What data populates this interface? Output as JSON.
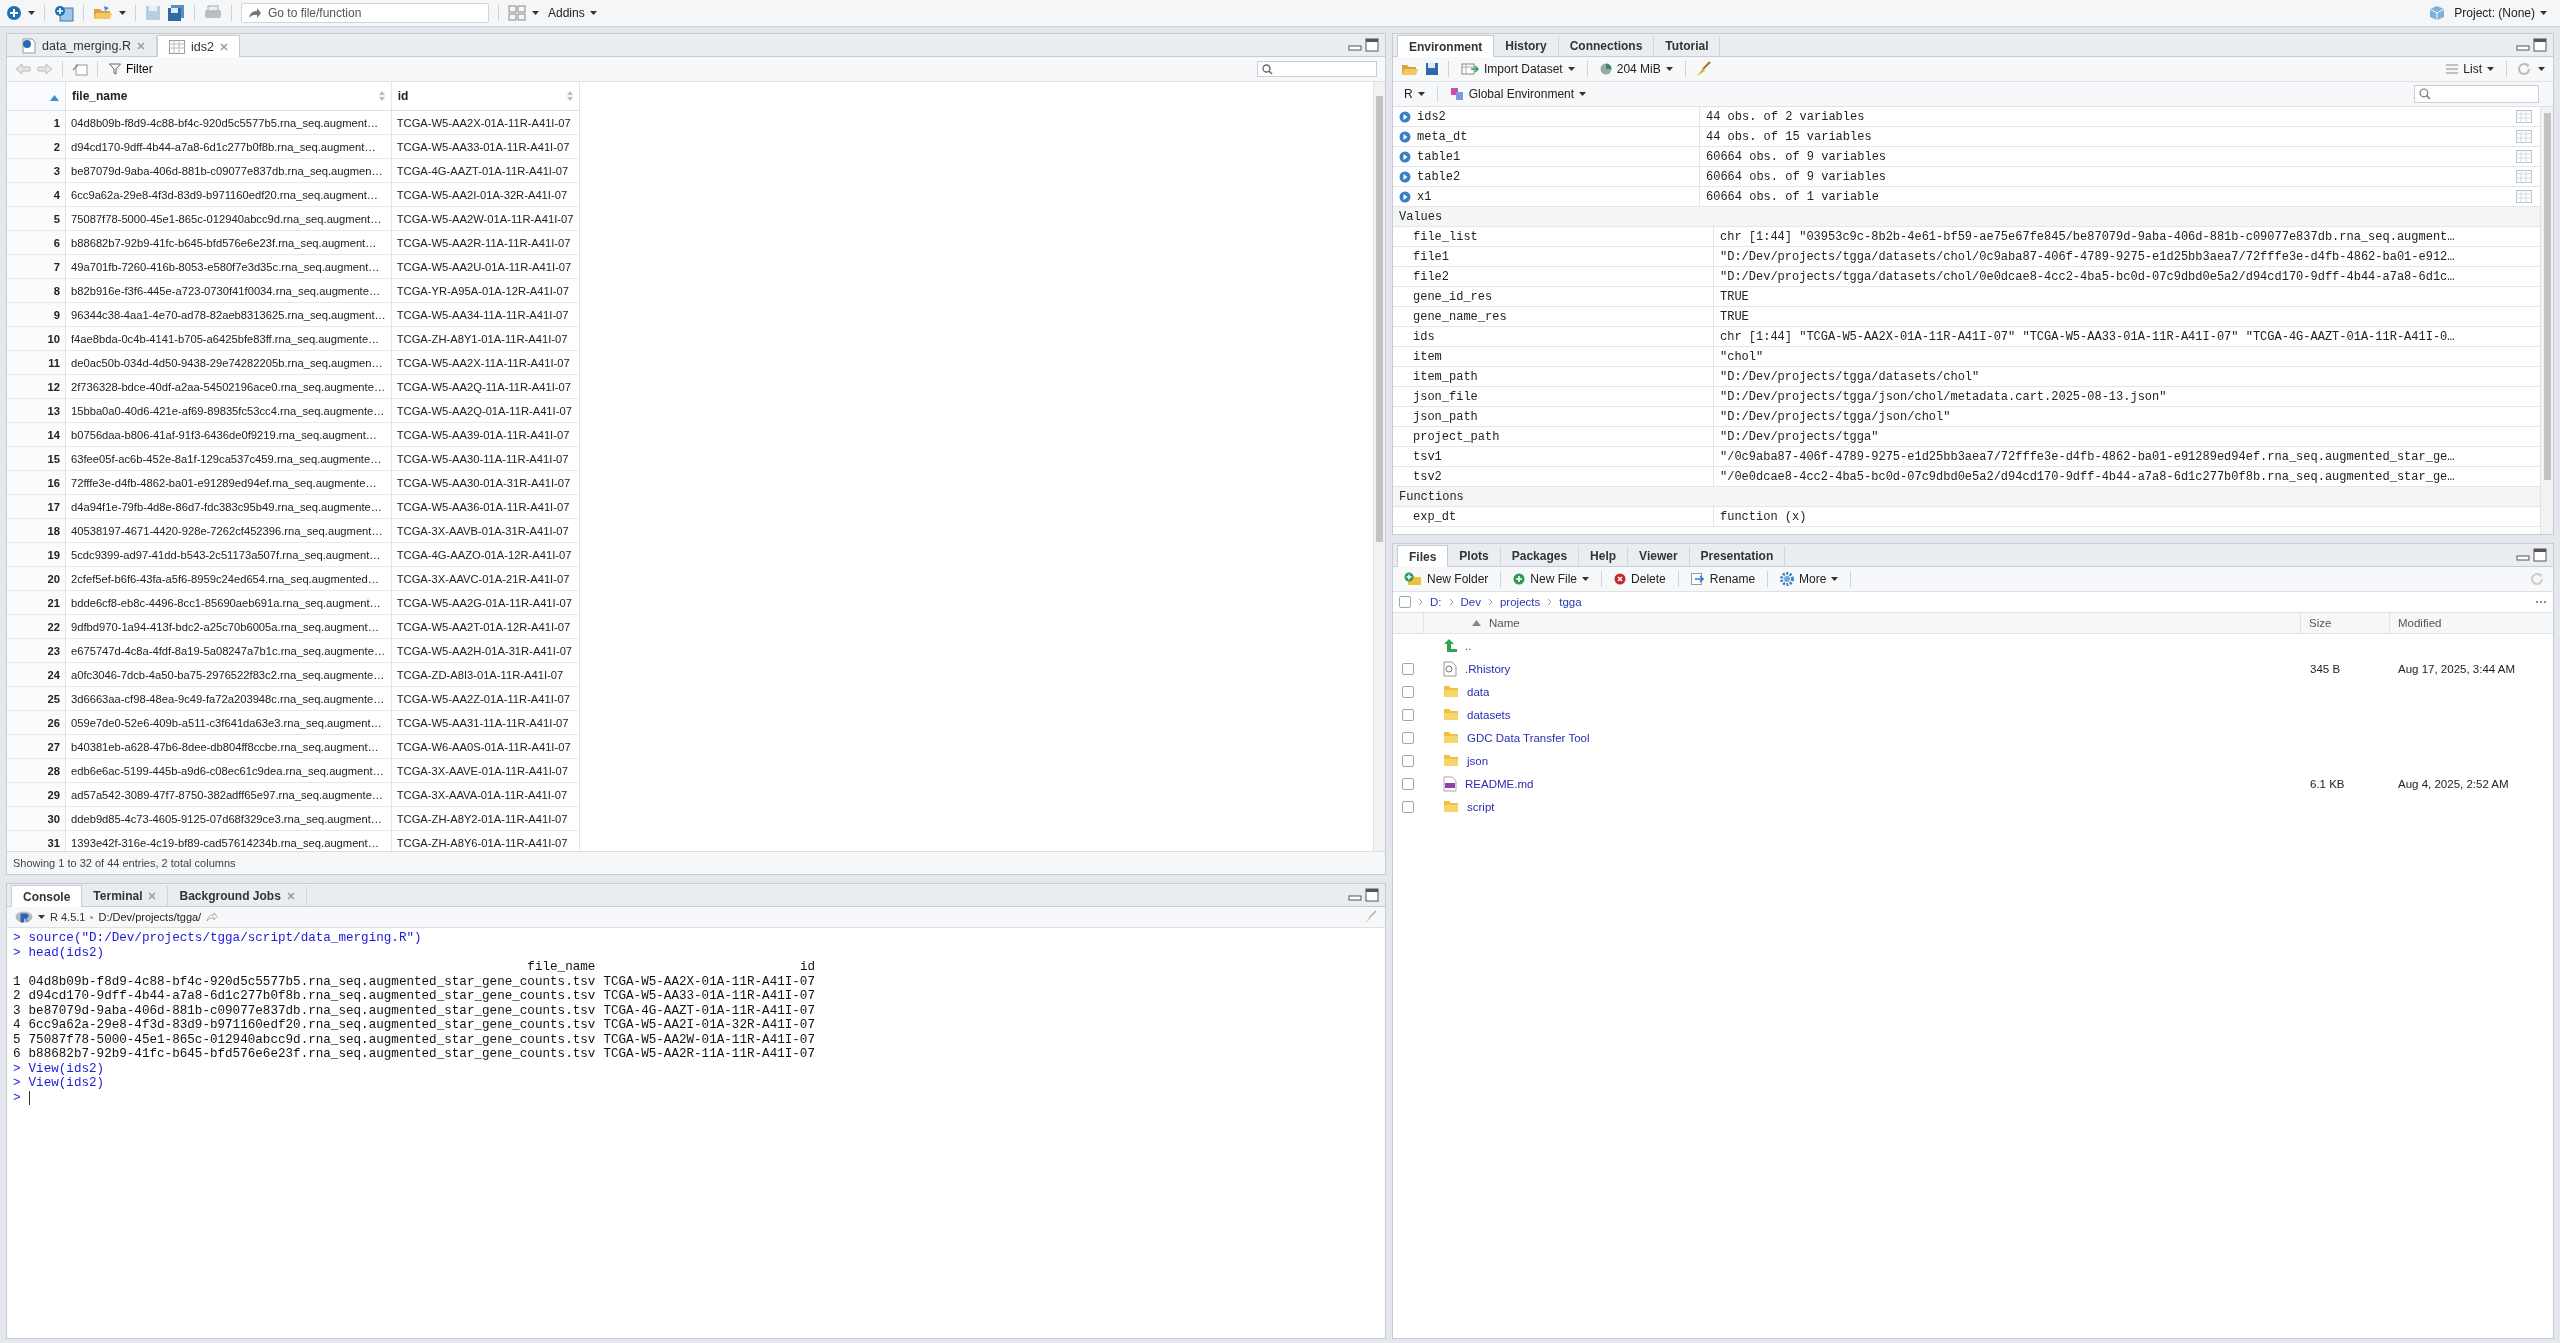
{
  "toolbar": {
    "goto": {
      "placeholder": "Go to file/function"
    },
    "addins": "Addins",
    "project": "Project: (None)"
  },
  "source_pane": {
    "tabs": [
      {
        "label": "data_merging.R",
        "kind": "script",
        "selected": false
      },
      {
        "label": "ids2",
        "kind": "table",
        "selected": true
      }
    ],
    "filter": "Filter",
    "table": {
      "columns": [
        "file_name",
        "id"
      ],
      "rows": [
        {
          "n": "1",
          "file_name": "04d8b09b-f8d9-4c88-bf4c-920d5c5577b5.rna_seq.augment…",
          "id": "TCGA-W5-AA2X-01A-11R-A41I-07"
        },
        {
          "n": "2",
          "file_name": "d94cd170-9dff-4b44-a7a8-6d1c277b0f8b.rna_seq.augment…",
          "id": "TCGA-W5-AA33-01A-11R-A41I-07"
        },
        {
          "n": "3",
          "file_name": "be87079d-9aba-406d-881b-c09077e837db.rna_seq.augmen…",
          "id": "TCGA-4G-AAZT-01A-11R-A41I-07"
        },
        {
          "n": "4",
          "file_name": "6cc9a62a-29e8-4f3d-83d9-b971160edf20.rna_seq.augment…",
          "id": "TCGA-W5-AA2I-01A-32R-A41I-07"
        },
        {
          "n": "5",
          "file_name": "75087f78-5000-45e1-865c-012940abcc9d.rna_seq.augment…",
          "id": "TCGA-W5-AA2W-01A-11R-A41I-07"
        },
        {
          "n": "6",
          "file_name": "b88682b7-92b9-41fc-b645-bfd576e6e23f.rna_seq.augment…",
          "id": "TCGA-W5-AA2R-11A-11R-A41I-07"
        },
        {
          "n": "7",
          "file_name": "49a701fb-7260-416b-8053-e580f7e3d35c.rna_seq.augment…",
          "id": "TCGA-W5-AA2U-01A-11R-A41I-07"
        },
        {
          "n": "8",
          "file_name": "b82b916e-f3f6-445e-a723-0730f41f0034.rna_seq.augmente…",
          "id": "TCGA-YR-A95A-01A-12R-A41I-07"
        },
        {
          "n": "9",
          "file_name": "96344c38-4aa1-4e70-ad78-82aeb8313625.rna_seq.augment…",
          "id": "TCGA-W5-AA34-11A-11R-A41I-07"
        },
        {
          "n": "10",
          "file_name": "f4ae8bda-0c4b-4141-b705-a6425bfe83ff.rna_seq.augmente…",
          "id": "TCGA-ZH-A8Y1-01A-11R-A41I-07"
        },
        {
          "n": "11",
          "file_name": "de0ac50b-034d-4d50-9438-29e74282205b.rna_seq.augmen…",
          "id": "TCGA-W5-AA2X-11A-11R-A41I-07"
        },
        {
          "n": "12",
          "file_name": "2f736328-bdce-40df-a2aa-54502196ace0.rna_seq.augmente…",
          "id": "TCGA-W5-AA2Q-11A-11R-A41I-07"
        },
        {
          "n": "13",
          "file_name": "15bba0a0-40d6-421e-af69-89835fc53cc4.rna_seq.augmente…",
          "id": "TCGA-W5-AA2Q-01A-11R-A41I-07"
        },
        {
          "n": "14",
          "file_name": "b0756daa-b806-41af-91f3-6436de0f9219.rna_seq.augment…",
          "id": "TCGA-W5-AA39-01A-11R-A41I-07"
        },
        {
          "n": "15",
          "file_name": "63fee05f-ac6b-452e-8a1f-129ca537c459.rna_seq.augmente…",
          "id": "TCGA-W5-AA30-11A-11R-A41I-07"
        },
        {
          "n": "16",
          "file_name": "72fffe3e-d4fb-4862-ba01-e91289ed94ef.rna_seq.augmente…",
          "id": "TCGA-W5-AA30-01A-31R-A41I-07"
        },
        {
          "n": "17",
          "file_name": "d4a94f1e-79fb-4d8e-86d7-fdc383c95b49.rna_seq.augmente…",
          "id": "TCGA-W5-AA36-01A-11R-A41I-07"
        },
        {
          "n": "18",
          "file_name": "40538197-4671-4420-928e-7262cf452396.rna_seq.augment…",
          "id": "TCGA-3X-AAVB-01A-31R-A41I-07"
        },
        {
          "n": "19",
          "file_name": "5cdc9399-ad97-41dd-b543-2c51173a507f.rna_seq.augment…",
          "id": "TCGA-4G-AAZO-01A-12R-A41I-07"
        },
        {
          "n": "20",
          "file_name": "2cfef5ef-b6f6-43fa-a5f6-8959c24ed654.rna_seq.augmented…",
          "id": "TCGA-3X-AAVC-01A-21R-A41I-07"
        },
        {
          "n": "21",
          "file_name": "bdde6cf8-eb8c-4496-8cc1-85690aeb691a.rna_seq.augment…",
          "id": "TCGA-W5-AA2G-01A-11R-A41I-07"
        },
        {
          "n": "22",
          "file_name": "9dfbd970-1a94-413f-bdc2-a25c70b6005a.rna_seq.augment…",
          "id": "TCGA-W5-AA2T-01A-12R-A41I-07"
        },
        {
          "n": "23",
          "file_name": "e675747d-4c8a-4fdf-8a19-5a08247a7b1c.rna_seq.augmente…",
          "id": "TCGA-W5-AA2H-01A-31R-A41I-07"
        },
        {
          "n": "24",
          "file_name": "a0fc3046-7dcb-4a50-ba75-2976522f83c2.rna_seq.augmente…",
          "id": "TCGA-ZD-A8I3-01A-11R-A41I-07"
        },
        {
          "n": "25",
          "file_name": "3d6663aa-cf98-48ea-9c49-fa72a203948c.rna_seq.augmente…",
          "id": "TCGA-W5-AA2Z-01A-11R-A41I-07"
        },
        {
          "n": "26",
          "file_name": "059e7de0-52e6-409b-a511-c3f641da63e3.rna_seq.augment…",
          "id": "TCGA-W5-AA31-11A-11R-A41I-07"
        },
        {
          "n": "27",
          "file_name": "b40381eb-a628-47b6-8dee-db804ff8ccbe.rna_seq.augment…",
          "id": "TCGA-W6-AA0S-01A-11R-A41I-07"
        },
        {
          "n": "28",
          "file_name": "edb6e6ac-5199-445b-a9d6-c08ec61c9dea.rna_seq.augment…",
          "id": "TCGA-3X-AAVE-01A-11R-A41I-07"
        },
        {
          "n": "29",
          "file_name": "ad57a542-3089-47f7-8750-382adff65e97.rna_seq.augmente…",
          "id": "TCGA-3X-AAVA-01A-11R-A41I-07"
        },
        {
          "n": "30",
          "file_name": "ddeb9d85-4c73-4605-9125-07d68f329ce3.rna_seq.augment…",
          "id": "TCGA-ZH-A8Y2-01A-11R-A41I-07"
        },
        {
          "n": "31",
          "file_name": "1393e42f-316e-4c19-bf89-cad57614234b.rna_seq.augment…",
          "id": "TCGA-ZH-A8Y6-01A-11R-A41I-07"
        }
      ]
    },
    "status": "Showing 1 to 32 of 44 entries, 2 total columns"
  },
  "console_pane": {
    "tabs": [
      {
        "label": "Console",
        "selected": true,
        "closable": false
      },
      {
        "label": "Terminal",
        "selected": false,
        "closable": true
      },
      {
        "label": "Background Jobs",
        "selected": false,
        "closable": true
      }
    ],
    "version": "R 4.5.1",
    "path": "D:/Dev/projects/tgga/",
    "lines": [
      {
        "kind": "input",
        "prompt": ">",
        "text": "source(\"D:/Dev/projects/tgga/script/data_merging.R\")"
      },
      {
        "kind": "input",
        "prompt": ">",
        "text": "head(ids2)"
      },
      {
        "kind": "frame",
        "header": [
          "file_name",
          "id"
        ],
        "rows": [
          [
            "1",
            "04d8b09b-f8d9-4c88-bf4c-920d5c5577b5.rna_seq.augmented_star_gene_counts.tsv",
            "TCGA-W5-AA2X-01A-11R-A41I-07"
          ],
          [
            "2",
            "d94cd170-9dff-4b44-a7a8-6d1c277b0f8b.rna_seq.augmented_star_gene_counts.tsv",
            "TCGA-W5-AA33-01A-11R-A41I-07"
          ],
          [
            "3",
            "be87079d-9aba-406d-881b-c09077e837db.rna_seq.augmented_star_gene_counts.tsv",
            "TCGA-4G-AAZT-01A-11R-A41I-07"
          ],
          [
            "4",
            "6cc9a62a-29e8-4f3d-83d9-b971160edf20.rna_seq.augmented_star_gene_counts.tsv",
            "TCGA-W5-AA2I-01A-32R-A41I-07"
          ],
          [
            "5",
            "75087f78-5000-45e1-865c-012940abcc9d.rna_seq.augmented_star_gene_counts.tsv",
            "TCGA-W5-AA2W-01A-11R-A41I-07"
          ],
          [
            "6",
            "b88682b7-92b9-41fc-b645-bfd576e6e23f.rna_seq.augmented_star_gene_counts.tsv",
            "TCGA-W5-AA2R-11A-11R-A41I-07"
          ]
        ]
      },
      {
        "kind": "input",
        "prompt": ">",
        "text": "View(ids2)"
      },
      {
        "kind": "input",
        "prompt": ">",
        "text": "View(ids2)"
      },
      {
        "kind": "input",
        "prompt": ">"
      }
    ]
  },
  "environment_pane": {
    "tabs": [
      {
        "label": "Environment",
        "selected": true
      },
      {
        "label": "History",
        "selected": false
      },
      {
        "label": "Connections",
        "selected": false
      },
      {
        "label": "Tutorial",
        "selected": false
      }
    ],
    "import": "Import Dataset",
    "memory": "204 MiB",
    "view": "List",
    "language": "R",
    "scope": "Global Environment",
    "data": [
      {
        "name": "ids2",
        "value": "44 obs. of 2 variables"
      },
      {
        "name": "meta_dt",
        "value": "44 obs. of 15 variables"
      },
      {
        "name": "table1",
        "value": "60664 obs. of 9 variables"
      },
      {
        "name": "table2",
        "value": "60664 obs. of 9 variables"
      },
      {
        "name": "x1",
        "value": "60664 obs. of 1 variable"
      }
    ],
    "sections": [
      {
        "title": "Values",
        "rows": [
          {
            "name": "file_list",
            "value": "chr [1:44] \"03953c9c-8b2b-4e61-bf59-ae75e67fe845/be87079d-9aba-406d-881b-c09077e837db.rna_seq.augment…"
          },
          {
            "name": "file1",
            "value": "\"D:/Dev/projects/tgga/datasets/chol/0c9aba87-406f-4789-9275-e1d25bb3aea7/72fffe3e-d4fb-4862-ba01-e912…"
          },
          {
            "name": "file2",
            "value": "\"D:/Dev/projects/tgga/datasets/chol/0e0dcae8-4cc2-4ba5-bc0d-07c9dbd0e5a2/d94cd170-9dff-4b44-a7a8-6d1c…"
          },
          {
            "name": "gene_id_res",
            "value": "TRUE"
          },
          {
            "name": "gene_name_res",
            "value": "TRUE"
          },
          {
            "name": "ids",
            "value": "chr [1:44] \"TCGA-W5-AA2X-01A-11R-A41I-07\" \"TCGA-W5-AA33-01A-11R-A41I-07\" \"TCGA-4G-AAZT-01A-11R-A41I-0…"
          },
          {
            "name": "item",
            "value": "\"chol\""
          },
          {
            "name": "item_path",
            "value": "\"D:/Dev/projects/tgga/datasets/chol\""
          },
          {
            "name": "json_file",
            "value": "\"D:/Dev/projects/tgga/json/chol/metadata.cart.2025-08-13.json\""
          },
          {
            "name": "json_path",
            "value": "\"D:/Dev/projects/tgga/json/chol\""
          },
          {
            "name": "project_path",
            "value": "\"D:/Dev/projects/tgga\""
          },
          {
            "name": "tsv1",
            "value": "\"/0c9aba87-406f-4789-9275-e1d25bb3aea7/72fffe3e-d4fb-4862-ba01-e91289ed94ef.rna_seq.augmented_star_ge…"
          },
          {
            "name": "tsv2",
            "value": "\"/0e0dcae8-4cc2-4ba5-bc0d-07c9dbd0e5a2/d94cd170-9dff-4b44-a7a8-6d1c277b0f8b.rna_seq.augmented_star_ge…"
          }
        ]
      },
      {
        "title": "Functions",
        "rows": [
          {
            "name": "exp_dt",
            "value": "function (x)"
          }
        ]
      }
    ]
  },
  "files_pane": {
    "tabs": [
      {
        "label": "Files",
        "selected": true
      },
      {
        "label": "Plots",
        "selected": false
      },
      {
        "label": "Packages",
        "selected": false
      },
      {
        "label": "Help",
        "selected": false
      },
      {
        "label": "Viewer",
        "selected": false
      },
      {
        "label": "Presentation",
        "selected": false
      }
    ],
    "actions": [
      {
        "label": "New Folder",
        "kind": "folder",
        "menu": false
      },
      {
        "label": "New File",
        "kind": "file",
        "menu": true
      },
      {
        "label": "Delete",
        "kind": "delete",
        "menu": false
      },
      {
        "label": "Rename",
        "kind": "rename",
        "menu": false
      },
      {
        "label": "More",
        "kind": "gear",
        "menu": true
      }
    ],
    "all_checked": false,
    "breadcrumb": [
      "D:",
      "Dev",
      "projects",
      "tgga"
    ],
    "columns": [
      "Name",
      "Size",
      "Modified"
    ],
    "rows": [
      {
        "kind": "up",
        "name": ".."
      },
      {
        "kind": "file",
        "name": ".Rhistory",
        "size": "345 B",
        "modified": "Aug 17, 2025, 3:44 AM",
        "checked": false
      },
      {
        "kind": "folder",
        "name": "data",
        "checked": false
      },
      {
        "kind": "folder",
        "name": "datasets",
        "checked": false
      },
      {
        "kind": "folder",
        "name": "GDC Data Transfer Tool",
        "checked": false
      },
      {
        "kind": "folder",
        "name": "json",
        "checked": false
      },
      {
        "kind": "md",
        "name": "README.md",
        "size": "6.1 KB",
        "modified": "Aug 4, 2025, 2:52 AM",
        "checked": false
      },
      {
        "kind": "folder",
        "name": "script",
        "checked": false
      }
    ]
  }
}
